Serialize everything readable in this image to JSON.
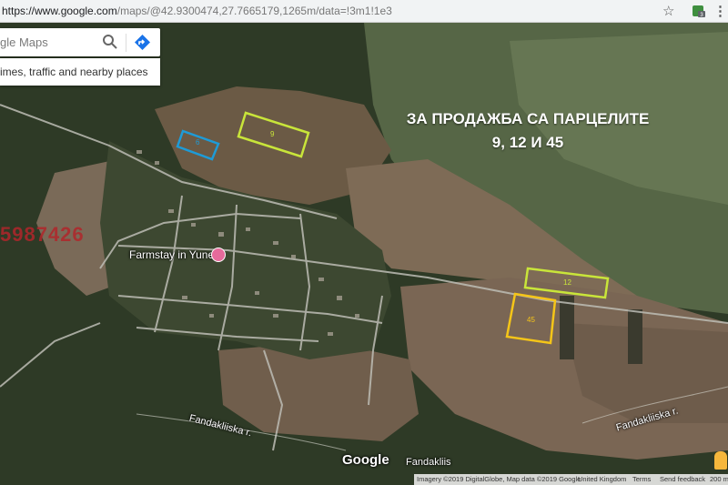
{
  "browser": {
    "url_host": "https://www.google.com",
    "url_rest": "/maps/@42.9300474,27.7665179,1265m/data=!3m1!1e3",
    "star_icon": "star-icon",
    "extension_badge": "3"
  },
  "search": {
    "placeholder": "gle Maps",
    "hint": "imes, traffic and nearby places"
  },
  "overlay": {
    "headline_line1": "ЗА ПРОДАЖБА СА ПАРЦЕЛИТЕ",
    "headline_line2": "9, 12 И 45",
    "phone_partial": "5987426"
  },
  "plots": [
    {
      "label": "6",
      "color": "#1e9bd7"
    },
    {
      "label": "9",
      "color": "#c9e53a"
    },
    {
      "label": "12",
      "color": "#c9e53a"
    },
    {
      "label": "45",
      "color": "#f5c518"
    }
  ],
  "places": {
    "farmstay": "Farmstay in Yunets"
  },
  "roads": {
    "left": "Fandakliiska r.",
    "center": "Fandakliis",
    "right": "Fandakliiska r."
  },
  "footer": {
    "logo": "Google",
    "imagery": "Imagery ©2019 DigitalGlobe, Map data ©2019 Google",
    "country": "United Kingdom",
    "terms": "Terms",
    "feedback": "Send feedback",
    "scale": "200 m"
  }
}
